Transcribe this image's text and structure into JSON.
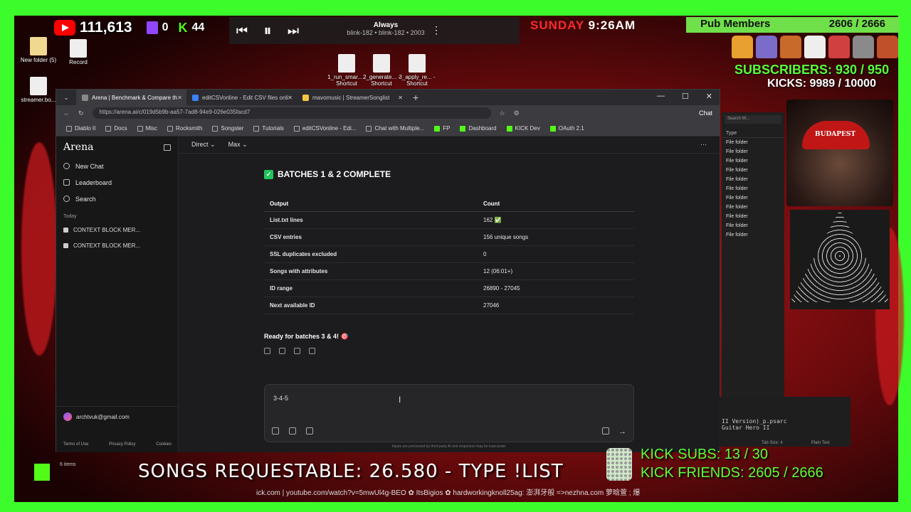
{
  "overlay": {
    "youtube_subs": "111,613",
    "twitch_count": "0",
    "kick_count": "44",
    "now_playing": {
      "title": "Always",
      "artist": "blink-182 • blink-182 • 2003"
    },
    "day": "SUNDAY",
    "time": "9:26AM",
    "pub_members_label": "Pub Members",
    "pub_members_value": "2606 / 2666",
    "subscribers": "SUBSCRIBERS: 930 / 950",
    "kicks": "KICKS: 9989 / 10000",
    "songs_requestable": "SONGS REQUESTABLE: 26.580 - TYPE !LIST",
    "kick_subs": "KICK SUBS: 13 / 30",
    "kick_friends": "KICK FRIENDS: 2605 / 2666",
    "ticker": "ick.com | youtube.com/watch?v=5mwUl4g-BEO ✿ ItsBigios ✿ hardworkingknoll25ag: 澎湃牙般 =>nezhna.com 萝晗萱 ; 爆",
    "items_count": "6 items",
    "colors": {
      "green_frame": "#3dfc2b",
      "red_bg": "#b5161a",
      "kick_green": "#53fc18"
    }
  },
  "desktop": {
    "icons": [
      {
        "label": "New folder (5)",
        "icon": "folder-icon"
      },
      {
        "label": "Record",
        "icon": "file-icon"
      },
      {
        "label": "streamer.bo...",
        "icon": "file-icon"
      },
      {
        "label": "1_run_smar... - Shortcut",
        "icon": "shortcut-icon"
      },
      {
        "label": "2_generate... - Shortcut",
        "icon": "shortcut-icon"
      },
      {
        "label": "3_apply_re... - Shortcut",
        "icon": "shortcut-icon"
      }
    ]
  },
  "browser": {
    "tabs": [
      {
        "label": "Arena | Benchmark & Compare th",
        "active": true
      },
      {
        "label": "editCSVonline - Edit CSV files onli",
        "active": false
      },
      {
        "label": "mavomusic | StreamerSonglist",
        "active": false
      }
    ],
    "url": "https://arena.ai/c/019d5b9b-aa57-7ad8-94e9-026e035facd7",
    "chat_button": "Chat",
    "bookmarks": [
      "Diablo II",
      "Docs",
      "Misc",
      "Rocksmith",
      "Songster",
      "Tutorials",
      "editCSVonline - Edi...",
      "Chat with Multiple...",
      "FP",
      "Dashboard",
      "KICK Dev",
      "OAuth 2.1"
    ]
  },
  "arena": {
    "logo": "Arena",
    "sidebar": {
      "new_chat": "New Chat",
      "leaderboard": "Leaderboard",
      "search": "Search",
      "section_today": "Today",
      "chats": [
        "CONTEXT BLOCK MER...",
        "CONTEXT BLOCK MER..."
      ],
      "user_email": "archtvuk@gmail.com",
      "footer": [
        "Terms of Use",
        "Privacy Policy",
        "Cookies"
      ]
    },
    "topbar": {
      "mode": "Direct",
      "model": "Max"
    },
    "message": {
      "heading": "BATCHES 1 & 2 COMPLETE",
      "table": {
        "headers": [
          "Output",
          "Count"
        ],
        "rows": [
          [
            "List.txt lines",
            "162 ✅"
          ],
          [
            "CSV entries",
            "156 unique songs"
          ],
          [
            "SSL duplicates excluded",
            "0"
          ],
          [
            "Songs with attributes",
            "12 (06:01+)"
          ],
          [
            "ID range",
            "26890 - 27045"
          ],
          [
            "Next available ID",
            "27046"
          ]
        ]
      },
      "footer_text": "Ready for batches 3 & 4! 🎯"
    },
    "composer": {
      "value": "3-4-5",
      "disclaimer": "Inputs are processed by third-party AI and responses may be inaccurate."
    }
  },
  "explorer": {
    "search_placeholder": "Search W...",
    "column": "Type",
    "rows": [
      "File folder",
      "File folder",
      "File folder",
      "File folder",
      "File folder",
      "File folder",
      "File folder",
      "File folder",
      "File folder",
      "File folder",
      "File folder"
    ]
  },
  "editor": {
    "lines": [
      "II Version)_p.psarc",
      "Guitar Hero II"
    ],
    "tab_size": "Tab Size: 4",
    "language": "Plain Text"
  },
  "webcam": {
    "cap_text": "BUDAPEST"
  }
}
